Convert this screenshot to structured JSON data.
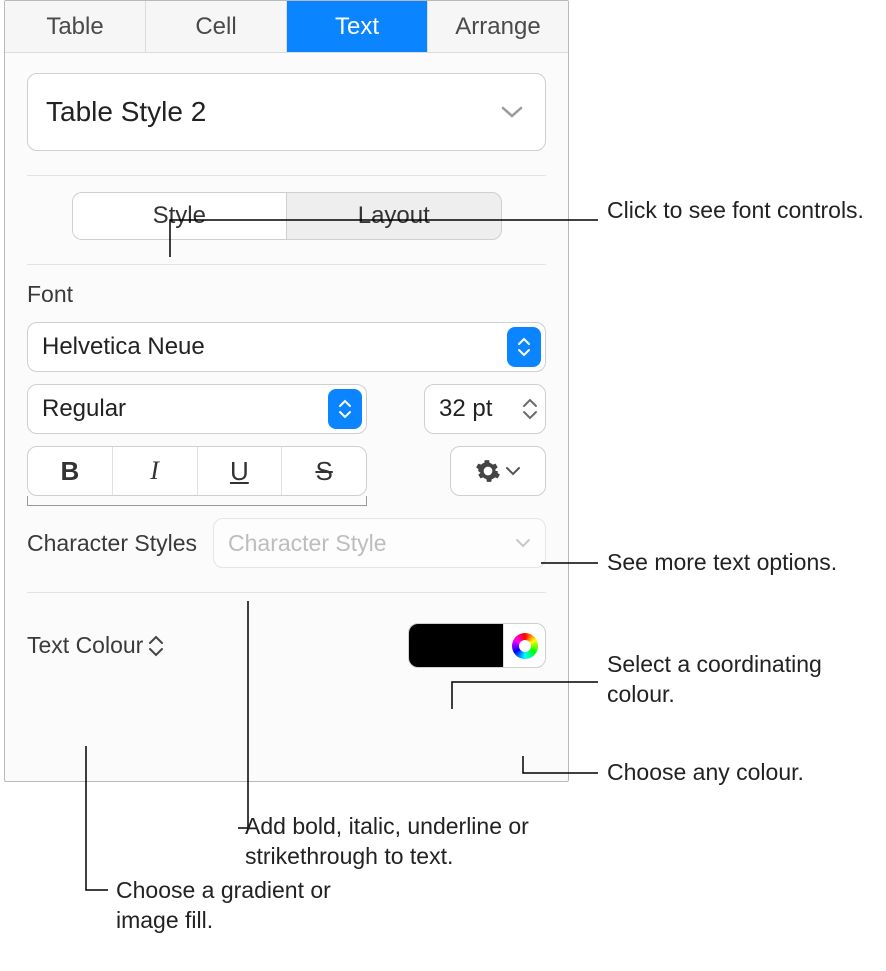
{
  "tabs": {
    "table": "Table",
    "cell": "Cell",
    "text": "Text",
    "arrange": "Arrange"
  },
  "styleDropdown": "Table Style 2",
  "seg": {
    "style": "Style",
    "layout": "Layout"
  },
  "fontLabel": "Font",
  "fontFamily": "Helvetica Neue",
  "fontWeight": "Regular",
  "fontSize": "32 pt",
  "charStylesLabel": "Character Styles",
  "charStylesPlaceholder": "Character Style",
  "textColourLabel": "Text Colour",
  "callouts": {
    "fontControls": "Click to see font controls.",
    "moreOptions": "See more text options.",
    "selectColour": "Select a coordinating colour.",
    "anyColour": "Choose any colour.",
    "gradientFill": "Choose a gradient or image fill.",
    "bius": "Add bold, italic, underline or strikethrough to text."
  }
}
